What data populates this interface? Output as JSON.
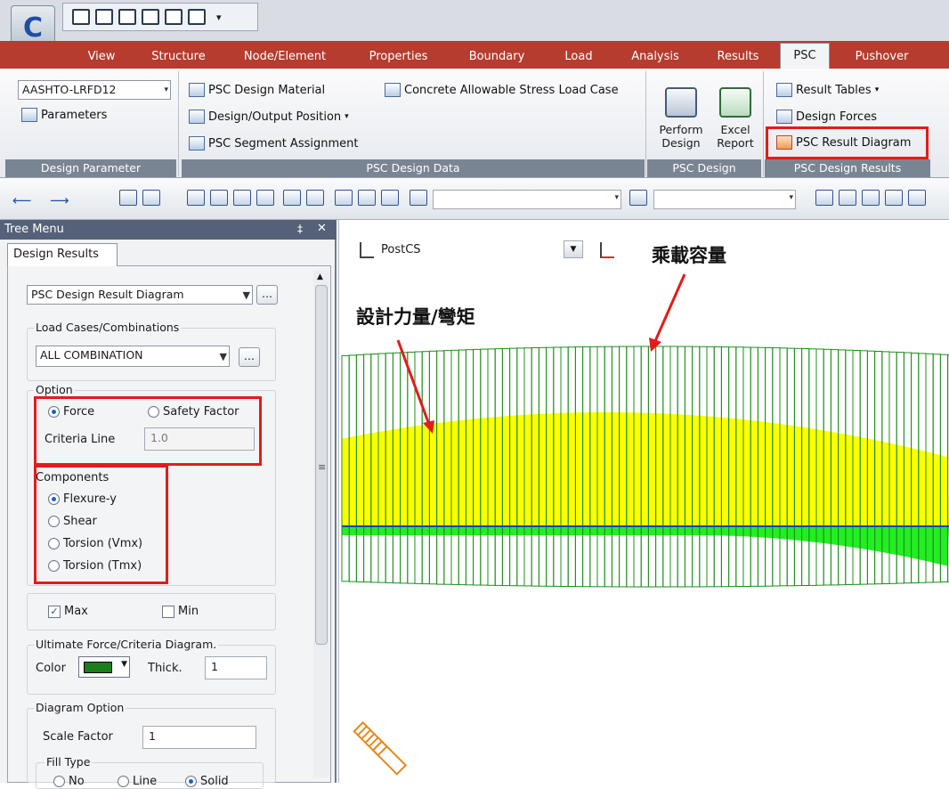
{
  "app": {
    "logo_letter": "C"
  },
  "tabs": [
    "View",
    "Structure",
    "Node/Element",
    "Properties",
    "Boundary",
    "Load",
    "Analysis",
    "Results",
    "PSC",
    "Pushover"
  ],
  "active_tab": "PSC",
  "ribbon": {
    "design_parameter": {
      "code_select": "AASHTO-LRFD12",
      "parameters": "Parameters",
      "label": "Design Parameter"
    },
    "design_data": {
      "material": "PSC Design Material",
      "allowable": "Concrete Allowable Stress Load Case",
      "position": "Design/Output Position",
      "segment": "PSC Segment Assignment",
      "label": "PSC Design Data"
    },
    "design": {
      "perform_line1": "Perform",
      "perform_line2": "Design",
      "excel_line1": "Excel",
      "excel_line2": "Report",
      "label": "PSC Design"
    },
    "results": {
      "tables": "Result Tables",
      "forces": "Design Forces",
      "diagram": "PSC Result Diagram",
      "label": "PSC Design Results"
    }
  },
  "tree": {
    "title": "Tree Menu",
    "pin": "4",
    "close": "✕",
    "tab": "Design Results",
    "mode_select": "PSC Design Result Diagram",
    "load_cases_label": "Load Cases/Combinations",
    "load_case_select": "ALL COMBINATION",
    "option_label": "Option",
    "force": "Force",
    "safety_factor": "Safety Factor",
    "criteria_line_label": "Criteria Line",
    "criteria_line_value": "1.0",
    "components_label": "Components",
    "flexure": "Flexure-y",
    "shear": "Shear",
    "torsion_vmx": "Torsion (Vmx)",
    "torsion_tmx": "Torsion (Tmx)",
    "max": "Max",
    "min": "Min",
    "ultimate_label": "Ultimate Force/Criteria Diagram.",
    "color_label": "Color",
    "thick_label": "Thick.",
    "thick_value": "1",
    "diagram_option_label": "Diagram Option",
    "scale_factor_label": "Scale Factor",
    "scale_factor_value": "1",
    "fill_type_label": "Fill Type",
    "fill_no": "No",
    "fill_line": "Line",
    "fill_solid": "Solid"
  },
  "viewport": {
    "stage_label": "PostCS",
    "annotation_capacity": "乘載容量",
    "annotation_force": "設計力量/彎矩"
  },
  "colors": {
    "capacity_line": "#1f8f1f",
    "force_fill": "#ffff00",
    "green_fill": "#22ee22",
    "highlight": "#e31b1b"
  }
}
